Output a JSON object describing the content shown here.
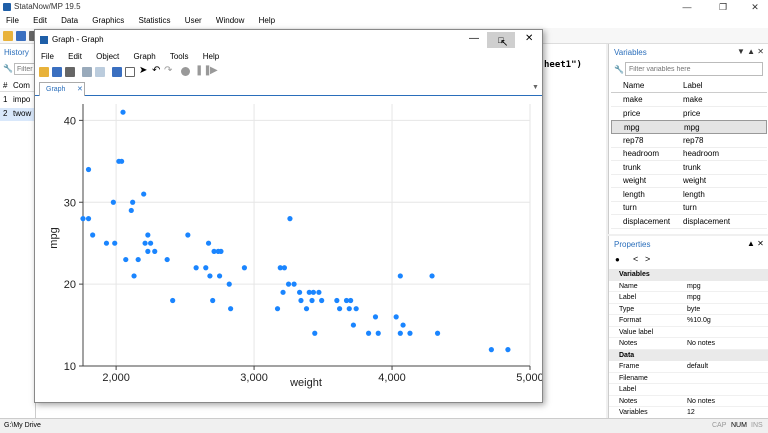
{
  "main_title": "StataNow/MP 19.5",
  "main_menu": [
    "File",
    "Edit",
    "Data",
    "Graphics",
    "Statistics",
    "User",
    "Window",
    "Help"
  ],
  "window_controls": [
    "minimize-icon",
    "maximize-icon",
    "close-icon"
  ],
  "history": {
    "title": "History",
    "filter_placeholder": "Filter",
    "header": [
      "#",
      "Com"
    ],
    "rows": [
      {
        "num": "1",
        "cmd": "impo"
      },
      {
        "num": "2",
        "cmd": "twow"
      }
    ]
  },
  "results_fragment": "heet1\")",
  "variables": {
    "title": "Variables",
    "filter_placeholder": "Filter variables here",
    "headers": [
      "Name",
      "Label"
    ],
    "rows": [
      {
        "name": "make",
        "label": "make"
      },
      {
        "name": "price",
        "label": "price"
      },
      {
        "name": "mpg",
        "label": "mpg"
      },
      {
        "name": "rep78",
        "label": "rep78"
      },
      {
        "name": "headroom",
        "label": "headroom"
      },
      {
        "name": "trunk",
        "label": "trunk"
      },
      {
        "name": "weight",
        "label": "weight"
      },
      {
        "name": "length",
        "label": "length"
      },
      {
        "name": "turn",
        "label": "turn"
      },
      {
        "name": "displacement",
        "label": "displacement"
      }
    ]
  },
  "properties": {
    "title": "Properties",
    "sections": [
      {
        "title": "Variables",
        "rows": [
          {
            "label": "Name",
            "value": "mpg"
          },
          {
            "label": "Label",
            "value": "mpg"
          },
          {
            "label": "Type",
            "value": "byte"
          },
          {
            "label": "Format",
            "value": "%10.0g"
          },
          {
            "label": "Value label",
            "value": ""
          },
          {
            "label": "Notes",
            "value": "No notes"
          }
        ]
      },
      {
        "title": "Data",
        "rows": [
          {
            "label": "Frame",
            "value": "default"
          },
          {
            "label": "Filename",
            "value": ""
          },
          {
            "label": "Label",
            "value": ""
          },
          {
            "label": "Notes",
            "value": "No notes"
          },
          {
            "label": "Variables",
            "value": "12"
          }
        ]
      }
    ]
  },
  "status": {
    "path": "G:\\My Drive",
    "caps": "CAP",
    "num": "NUM",
    "ins": "INS"
  },
  "graph_window": {
    "title": "Graph - Graph",
    "menu": [
      "File",
      "Edit",
      "Object",
      "Graph",
      "Tools",
      "Help"
    ],
    "tab": "Graph"
  },
  "colors": {
    "marker": "#1a85ff",
    "accent": "#2a6ebb"
  },
  "chart_data": {
    "type": "scatter",
    "xlabel": "weight",
    "ylabel": "mpg",
    "xlim": [
      1760,
      5000
    ],
    "ylim": [
      10,
      42
    ],
    "xticks": [
      2000,
      3000,
      4000,
      5000
    ],
    "xtick_labels": [
      "2,000",
      "3,000",
      "4,000",
      "5,000"
    ],
    "yticks": [
      10,
      20,
      30,
      40
    ],
    "ytick_labels": [
      "10",
      "20",
      "30",
      "40"
    ],
    "grid": true,
    "points": [
      [
        1760,
        28
      ],
      [
        1800,
        34
      ],
      [
        1800,
        28
      ],
      [
        1830,
        26
      ],
      [
        1930,
        25
      ],
      [
        1980,
        30
      ],
      [
        1990,
        25
      ],
      [
        2020,
        35
      ],
      [
        2040,
        35
      ],
      [
        2050,
        41
      ],
      [
        2070,
        23
      ],
      [
        2110,
        29
      ],
      [
        2120,
        30
      ],
      [
        2130,
        21
      ],
      [
        2160,
        23
      ],
      [
        2200,
        31
      ],
      [
        2210,
        25
      ],
      [
        2230,
        24
      ],
      [
        2230,
        26
      ],
      [
        2250,
        25
      ],
      [
        2280,
        24
      ],
      [
        2370,
        23
      ],
      [
        2410,
        18
      ],
      [
        2520,
        26
      ],
      [
        2580,
        22
      ],
      [
        2650,
        22
      ],
      [
        2670,
        25
      ],
      [
        2680,
        21
      ],
      [
        2700,
        18
      ],
      [
        2710,
        24
      ],
      [
        2740,
        24
      ],
      [
        2760,
        24
      ],
      [
        2750,
        21
      ],
      [
        2820,
        20
      ],
      [
        2830,
        17
      ],
      [
        2930,
        22
      ],
      [
        3170,
        17
      ],
      [
        3190,
        22
      ],
      [
        3210,
        19
      ],
      [
        3220,
        22
      ],
      [
        3250,
        20
      ],
      [
        3260,
        28
      ],
      [
        3290,
        20
      ],
      [
        3330,
        19
      ],
      [
        3340,
        18
      ],
      [
        3380,
        17
      ],
      [
        3400,
        19
      ],
      [
        3420,
        18
      ],
      [
        3430,
        19
      ],
      [
        3440,
        14
      ],
      [
        3470,
        19
      ],
      [
        3490,
        18
      ],
      [
        3600,
        18
      ],
      [
        3620,
        17
      ],
      [
        3670,
        18
      ],
      [
        3700,
        18
      ],
      [
        3690,
        17
      ],
      [
        3720,
        15
      ],
      [
        3740,
        17
      ],
      [
        3830,
        14
      ],
      [
        3880,
        16
      ],
      [
        3900,
        14
      ],
      [
        4030,
        16
      ],
      [
        4060,
        21
      ],
      [
        4060,
        14
      ],
      [
        4080,
        15
      ],
      [
        4130,
        14
      ],
      [
        4290,
        21
      ],
      [
        4330,
        14
      ],
      [
        4720,
        12
      ],
      [
        4840,
        12
      ]
    ]
  }
}
